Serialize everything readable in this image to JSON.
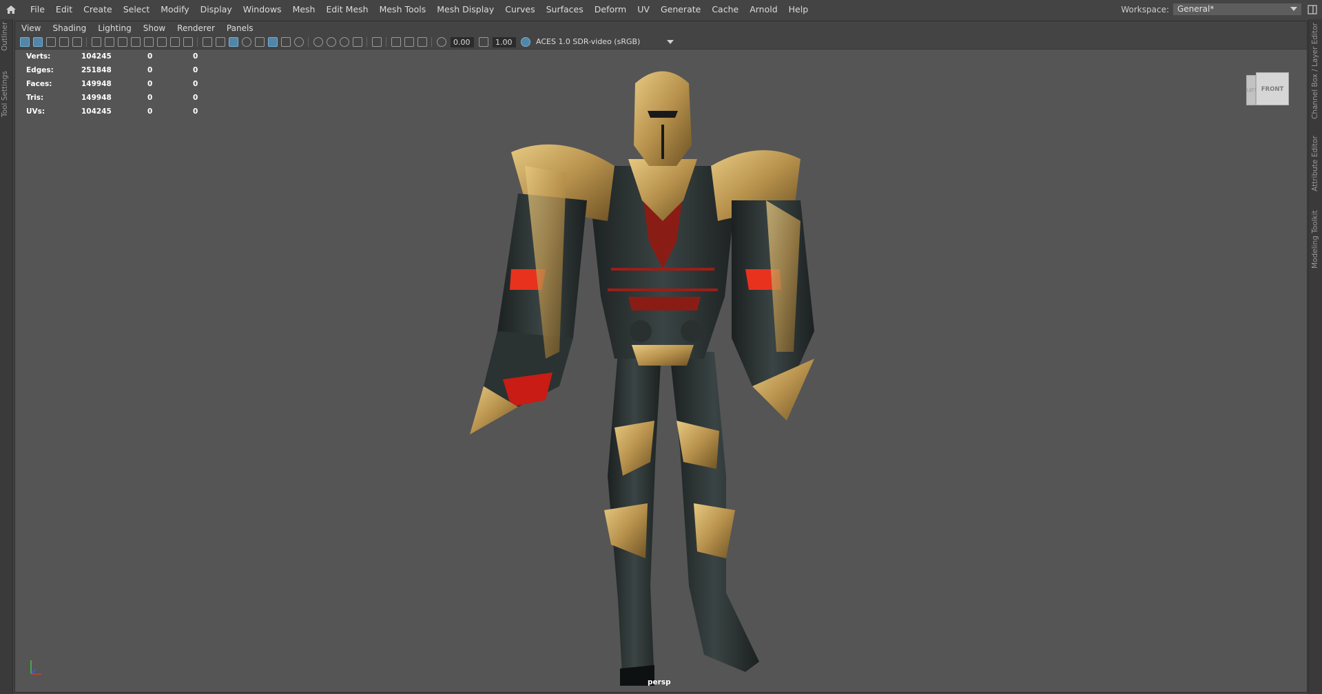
{
  "menubar": {
    "items": [
      "File",
      "Edit",
      "Create",
      "Select",
      "Modify",
      "Display",
      "Windows",
      "Mesh",
      "Edit Mesh",
      "Mesh Tools",
      "Mesh Display",
      "Curves",
      "Surfaces",
      "Deform",
      "UV",
      "Generate",
      "Cache",
      "Arnold",
      "Help"
    ]
  },
  "workspace": {
    "label": "Workspace:",
    "value": "General*"
  },
  "left_dock": {
    "tabs": [
      "Outliner",
      "Tool Settings"
    ]
  },
  "right_dock": {
    "tabs": [
      "Channel Box / Layer Editor",
      "Attribute Editor",
      "Modeling Toolkit"
    ]
  },
  "panel": {
    "menus": [
      "View",
      "Shading",
      "Lighting",
      "Show",
      "Renderer",
      "Panels"
    ],
    "toolbar": {
      "exposure": "0.00",
      "gamma": "1.00",
      "color_management": "ACES 1.0 SDR-video (sRGB)"
    },
    "camera": "persp"
  },
  "hud": {
    "rows": [
      {
        "label": "Verts:",
        "v1": "104245",
        "v2": "0",
        "v3": "0"
      },
      {
        "label": "Edges:",
        "v1": "251848",
        "v2": "0",
        "v3": "0"
      },
      {
        "label": "Faces:",
        "v1": "149948",
        "v2": "0",
        "v3": "0"
      },
      {
        "label": "Tris:",
        "v1": "149948",
        "v2": "0",
        "v3": "0"
      },
      {
        "label": "UVs:",
        "v1": "104245",
        "v2": "0",
        "v3": "0"
      }
    ]
  },
  "viewcube": {
    "front": "FRONT",
    "side": "LEFT"
  },
  "colors": {
    "accent": "#5285a6",
    "viewport_bg": "#555555",
    "ui_bg": "#444444",
    "gold": "#b8924d",
    "armor_dark": "#2e3535",
    "glow_red": "#e8321e"
  },
  "icons": [
    "maya-home-icon",
    "layout-icon",
    "select-camera-icon",
    "grid-icon",
    "wireframe-icon",
    "smooth-shade-icon",
    "textured-icon",
    "lights-icon",
    "shadows-icon",
    "xray-icon",
    "isolate-icon",
    "exposure-icon",
    "gamma-icon",
    "color-management-icon",
    "axis-gizmo-icon"
  ]
}
